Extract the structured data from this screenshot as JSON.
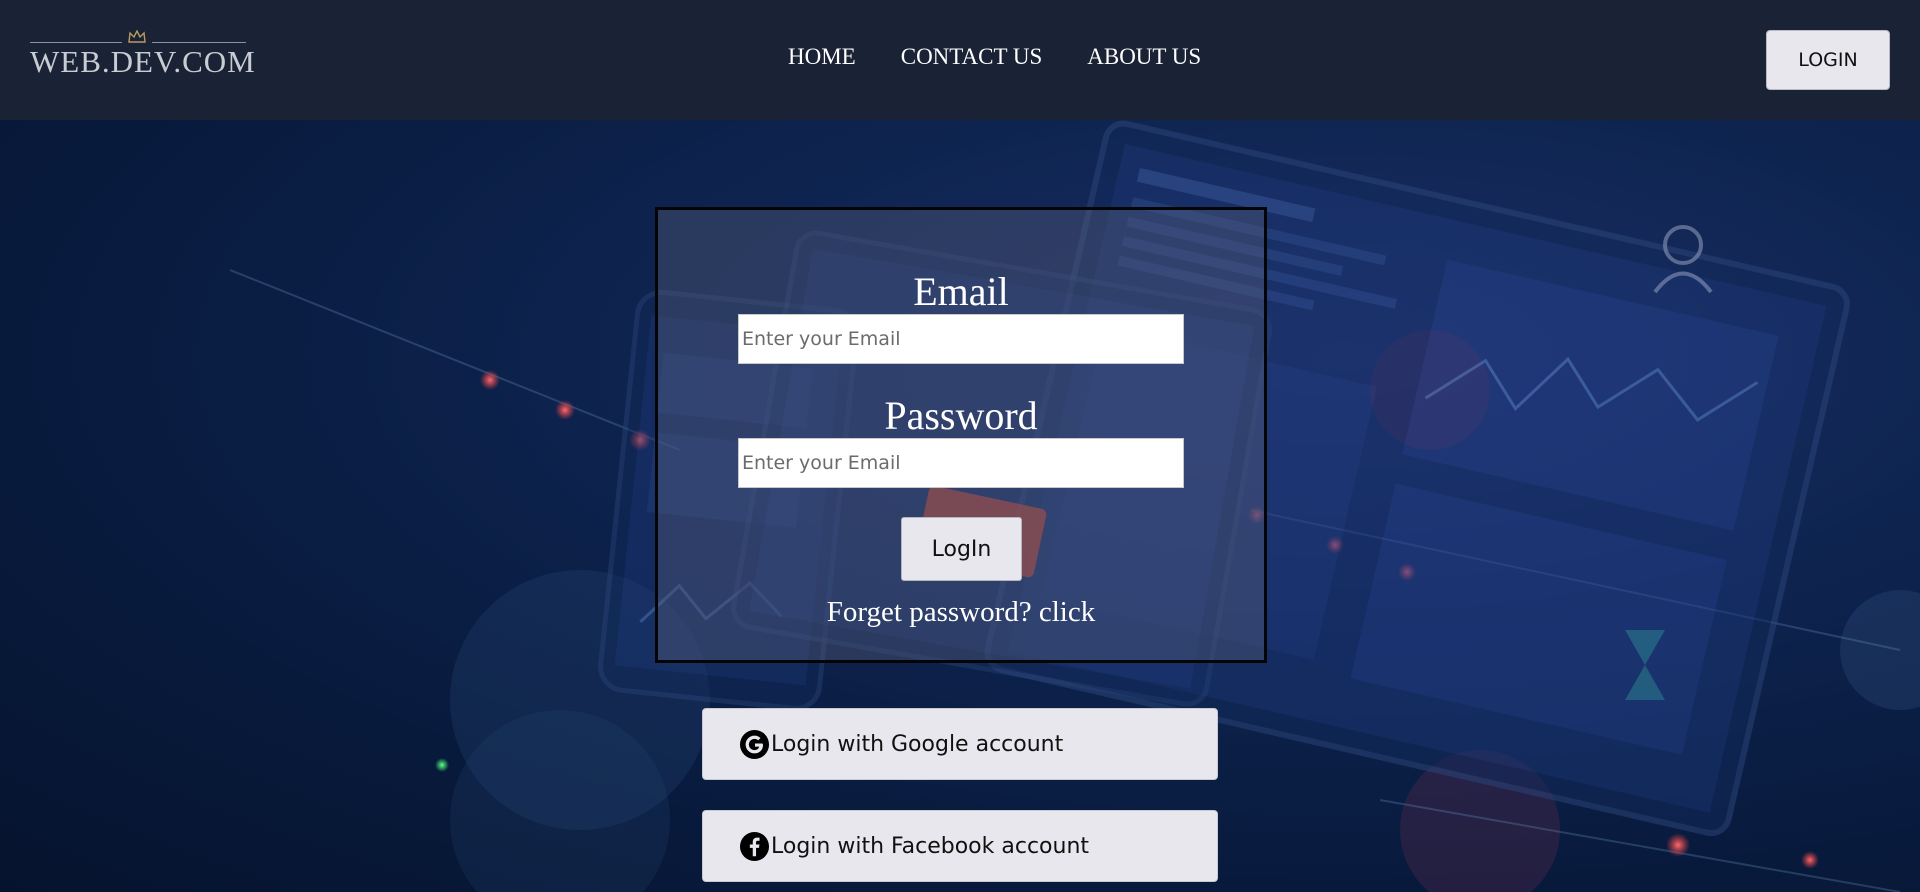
{
  "header": {
    "logo_text": "WEB.DEV.COM",
    "nav": [
      {
        "label": "HOME"
      },
      {
        "label": "CONTACT US"
      },
      {
        "label": "ABOUT US"
      }
    ],
    "login_button": "LOGIN"
  },
  "form": {
    "email_label": "Email",
    "email_placeholder": "Enter your Email",
    "password_label": "Password",
    "password_placeholder": "Enter your Email",
    "login_button": "LogIn",
    "forget_text": "Forget password? click"
  },
  "social": {
    "google": {
      "label": "Login with Google account",
      "icon": "google-icon"
    },
    "facebook": {
      "label": "Login with Facebook account",
      "icon": "facebook-icon"
    }
  },
  "colors": {
    "header_bg": "#1a2335",
    "button_bg": "#e8e7ed",
    "background": "#0e2450"
  }
}
